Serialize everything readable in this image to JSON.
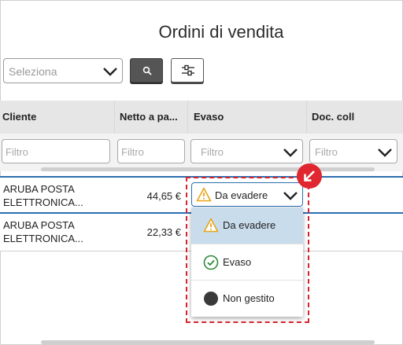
{
  "page": {
    "title": "Ordini di vendita"
  },
  "toolbar": {
    "select_placeholder": "Seleziona",
    "search_icon": "search-icon",
    "filter_icon": "sliders-icon"
  },
  "grid": {
    "columns": [
      "Cliente",
      "Netto a pa...",
      "Evaso",
      "Doc. coll"
    ],
    "filter_placeholder": "Filtro",
    "rows": [
      {
        "client_line1": "ARUBA POSTA",
        "client_line2": "ELETTRONICA...",
        "net": "44,65 €",
        "status": "Da evadere"
      },
      {
        "client_line1": "ARUBA POSTA",
        "client_line2": "ELETTRONICA...",
        "net": "22,33 €",
        "status": ""
      }
    ]
  },
  "dropdown": {
    "selected": "Da evadere",
    "options": [
      {
        "label": "Da evadere",
        "icon": "warning-icon"
      },
      {
        "label": "Evaso",
        "icon": "check-circle-icon"
      },
      {
        "label": "Non gestito",
        "icon": "filled-circle-icon"
      }
    ]
  },
  "colors": {
    "accent": "#2a6fb0",
    "highlight": "#d9232e",
    "selected_bg": "#c9dcec"
  }
}
